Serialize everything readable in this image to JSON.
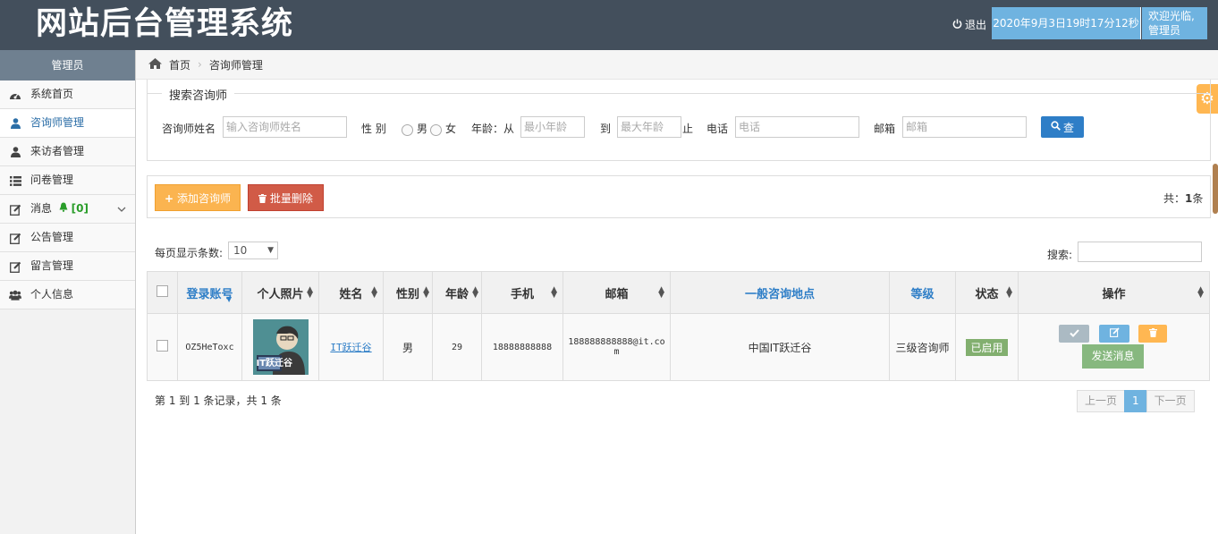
{
  "header": {
    "logo": "网站后台管理系统",
    "logout": "退出",
    "datetime": "2020年9月3日19时17分12秒",
    "welcome_line1": "欢迎光临,",
    "welcome_line2": "管理员"
  },
  "sidebar": {
    "title": "管理员",
    "items": [
      {
        "label": "系统首页",
        "icon": "dashboard-icon"
      },
      {
        "label": "咨询师管理",
        "icon": "user-icon"
      },
      {
        "label": "来访者管理",
        "icon": "user-icon"
      },
      {
        "label": "问卷管理",
        "icon": "list-icon"
      },
      {
        "label": "消息",
        "icon": "edit-icon",
        "badge": "[0]"
      },
      {
        "label": "公告管理",
        "icon": "edit-icon"
      },
      {
        "label": "留言管理",
        "icon": "edit-icon"
      },
      {
        "label": "个人信息",
        "icon": "users-icon"
      }
    ]
  },
  "breadcrumb": {
    "home": "首页",
    "current": "咨询师管理"
  },
  "search": {
    "legend": "搜索咨询师",
    "name_label": "咨询师姓名",
    "name_placeholder": "输入咨询师姓名",
    "gender_label": "性 别",
    "male": "男",
    "female": "女",
    "age_label": "年龄：从",
    "min_age_placeholder": "最小年龄",
    "to": "到",
    "max_age_placeholder": "最大年龄",
    "stop": "止",
    "phone_label": "电话",
    "phone_placeholder": "电话",
    "email_label": "邮箱",
    "email_placeholder": "邮箱",
    "search_button": "查"
  },
  "toolbar": {
    "add_button": "添加咨询师",
    "delete_button": "批量删除",
    "total_prefix": "共：",
    "total_count": "1",
    "total_suffix": "条"
  },
  "table_controls": {
    "per_page_label": "每页显示条数:",
    "per_page_value": "10",
    "search_label": "搜索:"
  },
  "table": {
    "headers": [
      "登录账号",
      "个人照片",
      "姓名",
      "性别",
      "年龄",
      "手机",
      "邮箱",
      "一般咨询地点",
      "等级",
      "状态",
      "操作"
    ],
    "rows": [
      {
        "account": "OZ5HeToxc",
        "photo_caption": "IT跃迁谷",
        "name": "IT跃迁谷",
        "gender": "男",
        "age": "29",
        "phone": "18888888888",
        "email_line1": "188888888888@it.co",
        "email_line2": "m",
        "location": "中国IT跃迁谷",
        "level": "三级咨询师",
        "status": "已启用",
        "send_message": "发送消息"
      }
    ]
  },
  "footer": {
    "info": "第 1 到 1 条记录，共 1 条",
    "prev": "上一页",
    "page": "1",
    "next": "下一页"
  }
}
